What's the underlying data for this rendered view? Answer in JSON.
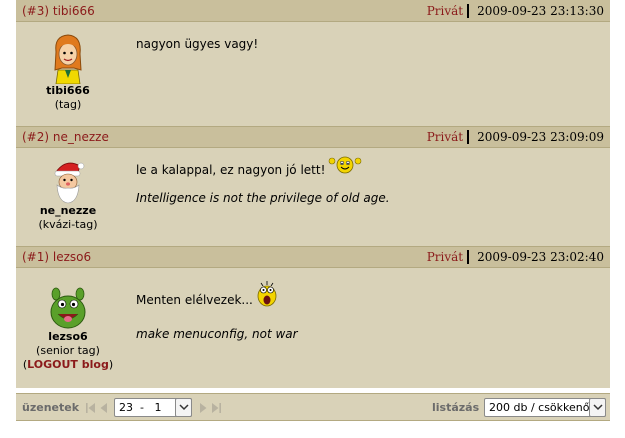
{
  "posts": [
    {
      "number": "(#3)",
      "author": "tibi666",
      "private_label": "Privát",
      "timestamp": "2009-09-23 23:13:30",
      "author_name": "tibi666",
      "author_rank": "(tag)",
      "text": "nagyon ügyes vagy!",
      "avatar": "girl-avatar-icon"
    },
    {
      "number": "(#2)",
      "author": "ne_nezze",
      "private_label": "Privát",
      "timestamp": "2009-09-23 23:09:09",
      "author_name": "ne_nezze",
      "author_rank": "(kvázi-tag)",
      "text": "le a kalappal, ez nagyon jó lett!",
      "signature": "Intelligence is not the privilege of old age.",
      "avatar": "santa-avatar-icon",
      "emoji": "waving-smiley-icon"
    },
    {
      "number": "(#1)",
      "author": "lezso6",
      "private_label": "Privát",
      "timestamp": "2009-09-23 23:02:40",
      "author_name": "lezso6",
      "author_rank": "(senior tag)",
      "author_extra_open": "(",
      "author_extra_link": "LOGOUT blog",
      "author_extra_close": ")",
      "text": "Menten elélvezek...",
      "signature": "make menuconfig, not war",
      "avatar": "green-monster-avatar-icon",
      "emoji": "shocked-smiley-icon"
    }
  ],
  "footer": {
    "messages_label": "üzenetek",
    "page_select_value": "23  -   1",
    "listing_label": "listázás",
    "listing_select_value": "200 db / csökkenő"
  },
  "colors": {
    "panel": "#d9d2b8",
    "header": "#c9bf9c",
    "accent": "#8b1a1a"
  }
}
